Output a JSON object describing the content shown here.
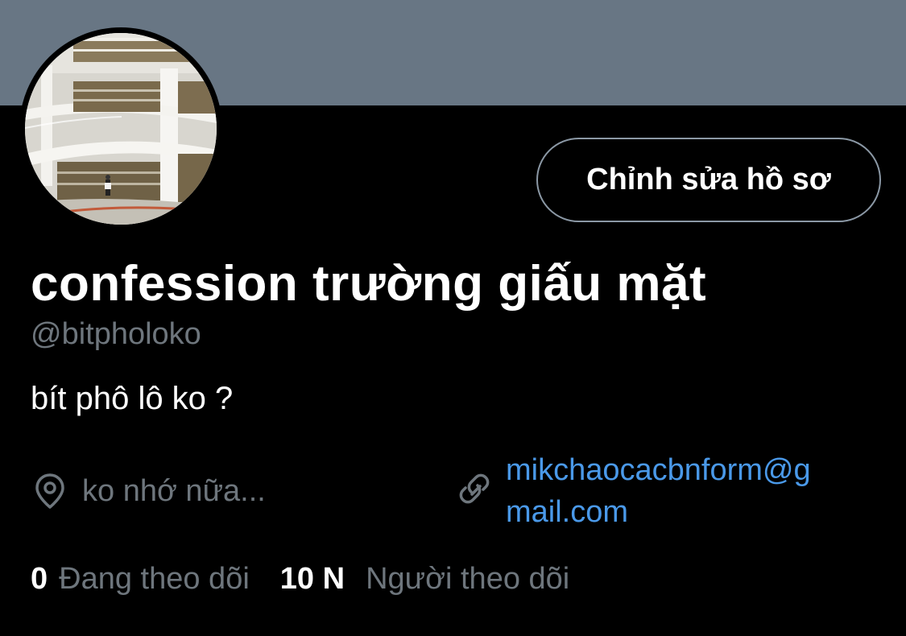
{
  "profile": {
    "display_name": "confession trường giấu mặt",
    "handle": "@bitpholoko",
    "bio": "bít phô lô ko ?",
    "location": "ko nhớ nữa...",
    "link_line1": "mikchaocacbnform@g",
    "link_line2": "mail.com",
    "edit_button_label": "Chỉnh sửa hồ sơ",
    "avatar_icon": "library-interior-photo"
  },
  "stats": {
    "following_count": "0",
    "following_label": "Đang theo dõi",
    "followers_count": "10 N",
    "followers_label": "Người theo dõi"
  },
  "colors": {
    "banner": "#687684",
    "background": "#000000",
    "muted_text": "#6e767d",
    "link": "#4a99e9",
    "button_border": "#8b98a5"
  },
  "icons": {
    "location": "location-pin-icon",
    "link": "link-chain-icon"
  }
}
